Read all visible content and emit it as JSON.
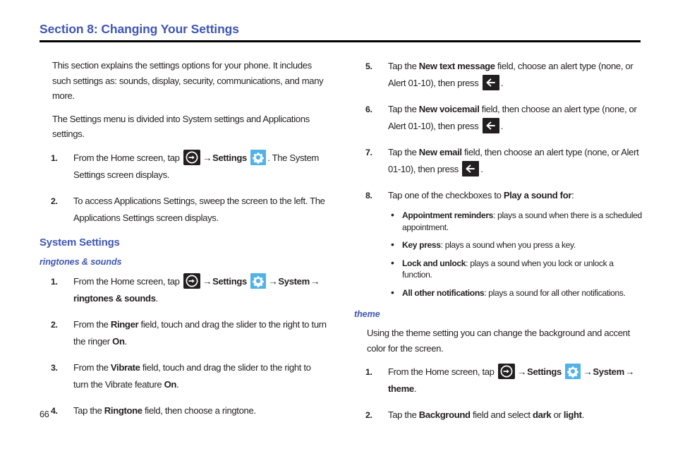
{
  "document": {
    "section_title": "Section 8: Changing Your Settings",
    "page_number": "66",
    "accent_color": "#3f56b5",
    "rule_color": "#000000",
    "icon_colors": {
      "apps_icon_bg": "#231f20",
      "back_icon_bg": "#231f20",
      "settings_icon_bg": "#4fb3e8",
      "icon_glyph": "#ffffff"
    }
  },
  "icons": {
    "apps": "apps-arrow-icon",
    "back": "back-arrow-icon",
    "settings": "settings-gear-icon",
    "inline_arrow": "→"
  },
  "left_column": {
    "intro_paragraph_1": "This section explains the settings options for your phone. It includes such settings as: sounds, display, security, communications, and many more.",
    "intro_paragraph_2": "The Settings menu is divided into System settings and Applications settings.",
    "intro_steps": [
      {
        "num": "1.",
        "pre": "From the Home screen, tap ",
        "mid": " → ",
        "bold1": "Settings",
        "post": ". The System Settings screen displays."
      },
      {
        "num": "2.",
        "text": "To access Applications Settings, sweep the screen to the left. The Applications Settings screen displays."
      }
    ],
    "heading": "System Settings",
    "subheading": "ringtones & sounds",
    "ringtone_steps": [
      {
        "num": "1.",
        "pre": "From the Home screen, tap ",
        "mid": " → ",
        "bold1": "Settings",
        "tail_arrow": " → ",
        "bold2": "System",
        "tail_arrow2": " → ",
        "bold3": "ringtones & sounds",
        "post": "."
      },
      {
        "num": "2.",
        "pre": "From the ",
        "bold1": "Ringer",
        "mid": " field, touch and drag the slider to the right to turn the ringer ",
        "bold2": "On",
        "post": "."
      },
      {
        "num": "3.",
        "pre": "From the ",
        "bold1": "Vibrate",
        "mid": " field, touch and drag the slider to the right to turn the Vibrate feature ",
        "bold2": "On",
        "post": "."
      },
      {
        "num": "4.",
        "pre": "Tap the ",
        "bold1": "Ringtone",
        "mid": " field, then choose a ringtone.",
        "post": ""
      }
    ]
  },
  "right_column": {
    "alert_steps": [
      {
        "num": "5.",
        "pre": "Tap the ",
        "bold1": "New text message",
        "mid": " field, choose an alert type (none, or Alert 01-10), then press ",
        "post": "."
      },
      {
        "num": "6.",
        "pre": "Tap the ",
        "bold1": "New voicemail",
        "mid": " field, then choose an alert type (none, or Alert 01-10), then press ",
        "post": "."
      },
      {
        "num": "7.",
        "pre": "Tap the ",
        "bold1": "New email",
        "mid": " field, then choose an alert type (none, or Alert 01-10), then press ",
        "post": "."
      }
    ],
    "checkbox_step": {
      "num": "8.",
      "pre": "Tap one of the checkboxes to ",
      "bold1": "Play a sound for",
      "post": ":"
    },
    "bullets": [
      {
        "bold": "Appointment reminders",
        "text": ": plays a sound when there is a scheduled appointment."
      },
      {
        "bold": "Key press",
        "text": ": plays a sound when you press a key."
      },
      {
        "bold": "Lock and unlock",
        "text": ": plays a sound when you lock or unlock a function."
      },
      {
        "bold": "All other notifications",
        "text": ": plays a sound for all other notifications."
      }
    ],
    "theme_subheading": "theme",
    "theme_paragraph": "Using the theme setting you can change the background and accent color for the screen.",
    "theme_steps": [
      {
        "num": "1.",
        "pre": "From the Home screen, tap ",
        "mid": " → ",
        "bold1": "Settings",
        "tail_arrow": " → ",
        "bold2": "System",
        "tail_arrow2": " → ",
        "bold3": "theme",
        "post": "."
      },
      {
        "num": "2.",
        "pre": "Tap the ",
        "bold1": "Background",
        "mid": " field and select ",
        "bold2": "dark",
        "mid2": " or ",
        "bold3": "light",
        "post": "."
      }
    ]
  }
}
